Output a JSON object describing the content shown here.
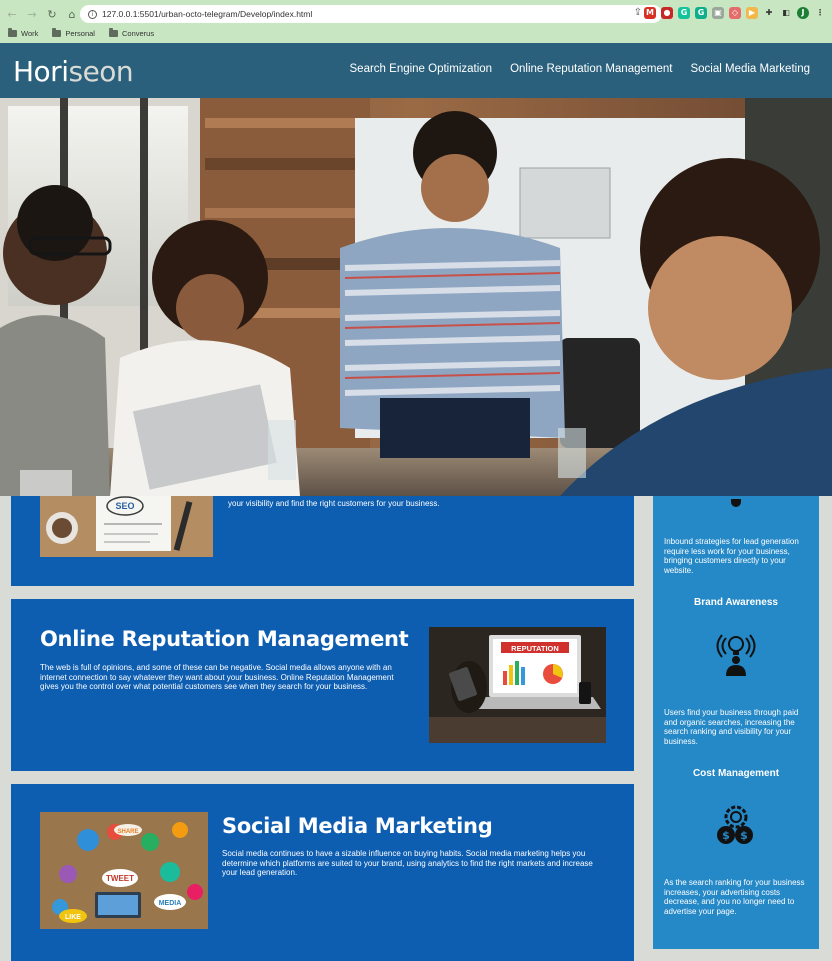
{
  "browser": {
    "url": "127.0.0.1:5501/urban-octo-telegram/Develop/index.html",
    "bookmarks": [
      "Work",
      "Personal",
      "Converus"
    ],
    "profile_initial": "J",
    "extensions": [
      {
        "name": "gmail-icon",
        "glyph": "M",
        "color": "#d93025"
      },
      {
        "name": "ublock-icon",
        "glyph": "●",
        "color": "#c62828"
      },
      {
        "name": "grammarly-icon",
        "glyph": "G",
        "color": "#15c39a"
      },
      {
        "name": "grammarly-alt-icon",
        "glyph": "G",
        "color": "#0fae8a"
      },
      {
        "name": "extension-icon",
        "glyph": "▣",
        "color": "#9aa79a"
      },
      {
        "name": "lastpass-icon",
        "glyph": "◇",
        "color": "#e66c6c"
      },
      {
        "name": "adblock-icon",
        "glyph": "▶",
        "color": "#f2b84b"
      }
    ]
  },
  "site": {
    "logo_main": "Hori",
    "logo_accent": "seon",
    "nav": [
      "Search Engine Optimization",
      "Online Reputation Management",
      "Social Media Marketing"
    ]
  },
  "sections": {
    "seo_text": "your visibility and find the right customers for your business.",
    "orm_title": "Online Reputation Management",
    "orm_text": "The web is full of opinions, and some of these can be negative. Social media allows anyone with an internet connection to say whatever they want about your business. Online Reputation Management gives you the control over what potential customers see when they search for your business.",
    "orm_image_label": "REPUTATION",
    "smm_title": "Social Media Marketing",
    "smm_text": "Social media continues to have a sizable influence on buying habits. Social media marketing helps you determine which platforms are suited to your brand, using analytics to find the right markets and increase your lead generation.",
    "seo_image_label": "SEO"
  },
  "benefits": {
    "lead_text": "Inbound strategies for lead generation require less work for your business, bringing customers directly to your website.",
    "brand_title": "Brand Awareness",
    "brand_text": "Users find your business through paid and organic searches, increasing the search ranking and visibility for your business.",
    "cost_title": "Cost Management",
    "cost_text": "As the search ranking for your business increases, your advertising costs decrease, and you no longer need to advertise your page."
  },
  "colors": {
    "header_bg": "#2a607c",
    "card_bg": "#0d5db1",
    "benefits_bg": "#2588c7",
    "page_bg": "#d9dcd6"
  }
}
